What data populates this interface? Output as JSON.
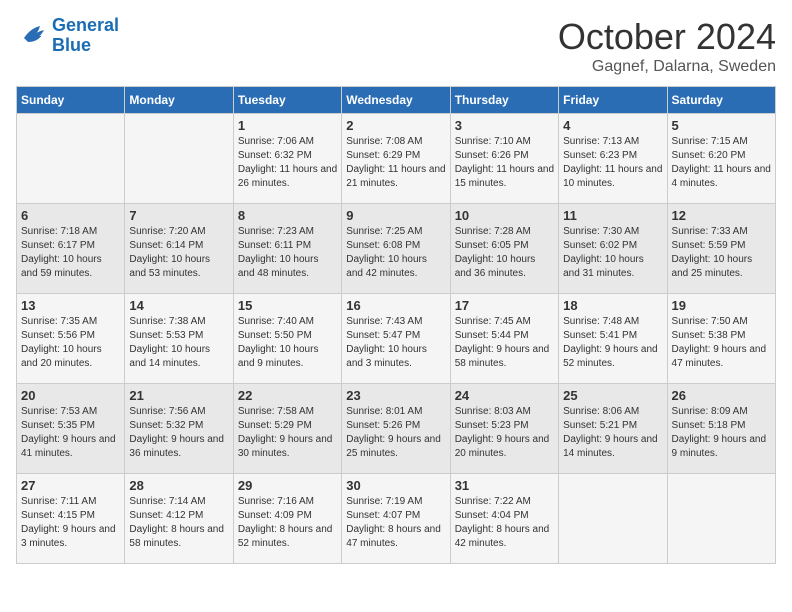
{
  "logo": {
    "line1": "General",
    "line2": "Blue"
  },
  "title": "October 2024",
  "subtitle": "Gagnef, Dalarna, Sweden",
  "days_of_week": [
    "Sunday",
    "Monday",
    "Tuesday",
    "Wednesday",
    "Thursday",
    "Friday",
    "Saturday"
  ],
  "weeks": [
    [
      {
        "day": "",
        "sunrise": "",
        "sunset": "",
        "daylight": ""
      },
      {
        "day": "",
        "sunrise": "",
        "sunset": "",
        "daylight": ""
      },
      {
        "day": "1",
        "sunrise": "Sunrise: 7:06 AM",
        "sunset": "Sunset: 6:32 PM",
        "daylight": "Daylight: 11 hours and 26 minutes."
      },
      {
        "day": "2",
        "sunrise": "Sunrise: 7:08 AM",
        "sunset": "Sunset: 6:29 PM",
        "daylight": "Daylight: 11 hours and 21 minutes."
      },
      {
        "day": "3",
        "sunrise": "Sunrise: 7:10 AM",
        "sunset": "Sunset: 6:26 PM",
        "daylight": "Daylight: 11 hours and 15 minutes."
      },
      {
        "day": "4",
        "sunrise": "Sunrise: 7:13 AM",
        "sunset": "Sunset: 6:23 PM",
        "daylight": "Daylight: 11 hours and 10 minutes."
      },
      {
        "day": "5",
        "sunrise": "Sunrise: 7:15 AM",
        "sunset": "Sunset: 6:20 PM",
        "daylight": "Daylight: 11 hours and 4 minutes."
      }
    ],
    [
      {
        "day": "6",
        "sunrise": "Sunrise: 7:18 AM",
        "sunset": "Sunset: 6:17 PM",
        "daylight": "Daylight: 10 hours and 59 minutes."
      },
      {
        "day": "7",
        "sunrise": "Sunrise: 7:20 AM",
        "sunset": "Sunset: 6:14 PM",
        "daylight": "Daylight: 10 hours and 53 minutes."
      },
      {
        "day": "8",
        "sunrise": "Sunrise: 7:23 AM",
        "sunset": "Sunset: 6:11 PM",
        "daylight": "Daylight: 10 hours and 48 minutes."
      },
      {
        "day": "9",
        "sunrise": "Sunrise: 7:25 AM",
        "sunset": "Sunset: 6:08 PM",
        "daylight": "Daylight: 10 hours and 42 minutes."
      },
      {
        "day": "10",
        "sunrise": "Sunrise: 7:28 AM",
        "sunset": "Sunset: 6:05 PM",
        "daylight": "Daylight: 10 hours and 36 minutes."
      },
      {
        "day": "11",
        "sunrise": "Sunrise: 7:30 AM",
        "sunset": "Sunset: 6:02 PM",
        "daylight": "Daylight: 10 hours and 31 minutes."
      },
      {
        "day": "12",
        "sunrise": "Sunrise: 7:33 AM",
        "sunset": "Sunset: 5:59 PM",
        "daylight": "Daylight: 10 hours and 25 minutes."
      }
    ],
    [
      {
        "day": "13",
        "sunrise": "Sunrise: 7:35 AM",
        "sunset": "Sunset: 5:56 PM",
        "daylight": "Daylight: 10 hours and 20 minutes."
      },
      {
        "day": "14",
        "sunrise": "Sunrise: 7:38 AM",
        "sunset": "Sunset: 5:53 PM",
        "daylight": "Daylight: 10 hours and 14 minutes."
      },
      {
        "day": "15",
        "sunrise": "Sunrise: 7:40 AM",
        "sunset": "Sunset: 5:50 PM",
        "daylight": "Daylight: 10 hours and 9 minutes."
      },
      {
        "day": "16",
        "sunrise": "Sunrise: 7:43 AM",
        "sunset": "Sunset: 5:47 PM",
        "daylight": "Daylight: 10 hours and 3 minutes."
      },
      {
        "day": "17",
        "sunrise": "Sunrise: 7:45 AM",
        "sunset": "Sunset: 5:44 PM",
        "daylight": "Daylight: 9 hours and 58 minutes."
      },
      {
        "day": "18",
        "sunrise": "Sunrise: 7:48 AM",
        "sunset": "Sunset: 5:41 PM",
        "daylight": "Daylight: 9 hours and 52 minutes."
      },
      {
        "day": "19",
        "sunrise": "Sunrise: 7:50 AM",
        "sunset": "Sunset: 5:38 PM",
        "daylight": "Daylight: 9 hours and 47 minutes."
      }
    ],
    [
      {
        "day": "20",
        "sunrise": "Sunrise: 7:53 AM",
        "sunset": "Sunset: 5:35 PM",
        "daylight": "Daylight: 9 hours and 41 minutes."
      },
      {
        "day": "21",
        "sunrise": "Sunrise: 7:56 AM",
        "sunset": "Sunset: 5:32 PM",
        "daylight": "Daylight: 9 hours and 36 minutes."
      },
      {
        "day": "22",
        "sunrise": "Sunrise: 7:58 AM",
        "sunset": "Sunset: 5:29 PM",
        "daylight": "Daylight: 9 hours and 30 minutes."
      },
      {
        "day": "23",
        "sunrise": "Sunrise: 8:01 AM",
        "sunset": "Sunset: 5:26 PM",
        "daylight": "Daylight: 9 hours and 25 minutes."
      },
      {
        "day": "24",
        "sunrise": "Sunrise: 8:03 AM",
        "sunset": "Sunset: 5:23 PM",
        "daylight": "Daylight: 9 hours and 20 minutes."
      },
      {
        "day": "25",
        "sunrise": "Sunrise: 8:06 AM",
        "sunset": "Sunset: 5:21 PM",
        "daylight": "Daylight: 9 hours and 14 minutes."
      },
      {
        "day": "26",
        "sunrise": "Sunrise: 8:09 AM",
        "sunset": "Sunset: 5:18 PM",
        "daylight": "Daylight: 9 hours and 9 minutes."
      }
    ],
    [
      {
        "day": "27",
        "sunrise": "Sunrise: 7:11 AM",
        "sunset": "Sunset: 4:15 PM",
        "daylight": "Daylight: 9 hours and 3 minutes."
      },
      {
        "day": "28",
        "sunrise": "Sunrise: 7:14 AM",
        "sunset": "Sunset: 4:12 PM",
        "daylight": "Daylight: 8 hours and 58 minutes."
      },
      {
        "day": "29",
        "sunrise": "Sunrise: 7:16 AM",
        "sunset": "Sunset: 4:09 PM",
        "daylight": "Daylight: 8 hours and 52 minutes."
      },
      {
        "day": "30",
        "sunrise": "Sunrise: 7:19 AM",
        "sunset": "Sunset: 4:07 PM",
        "daylight": "Daylight: 8 hours and 47 minutes."
      },
      {
        "day": "31",
        "sunrise": "Sunrise: 7:22 AM",
        "sunset": "Sunset: 4:04 PM",
        "daylight": "Daylight: 8 hours and 42 minutes."
      },
      {
        "day": "",
        "sunrise": "",
        "sunset": "",
        "daylight": ""
      },
      {
        "day": "",
        "sunrise": "",
        "sunset": "",
        "daylight": ""
      }
    ]
  ]
}
